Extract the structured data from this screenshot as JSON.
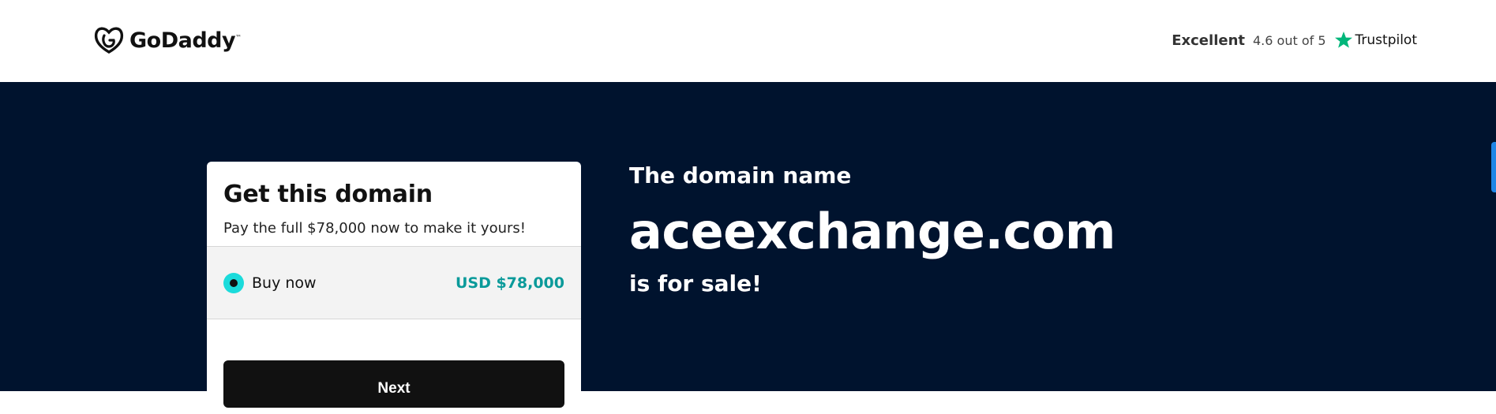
{
  "header": {
    "brand": "GoDaddy",
    "brand_mark": "™",
    "rating_label": "Excellent",
    "rating_score": "4.6 out of 5",
    "trustpilot": "Trustpilot"
  },
  "card": {
    "title": "Get this domain",
    "subtitle": "Pay the full $78,000 now to make it yours!",
    "option_label": "Buy now",
    "option_price": "USD $78,000",
    "next_button": "Next"
  },
  "hero": {
    "intro": "The domain name",
    "domain": "aceexchange.com",
    "outro": "is for sale!"
  },
  "colors": {
    "hero_bg": "#00132e",
    "accent_teal": "#1bdbdb",
    "price_teal": "#0a9a9a",
    "trustpilot_green": "#00b67a"
  },
  "icons": [
    "godaddy-logo-icon",
    "trustpilot-star-icon"
  ]
}
